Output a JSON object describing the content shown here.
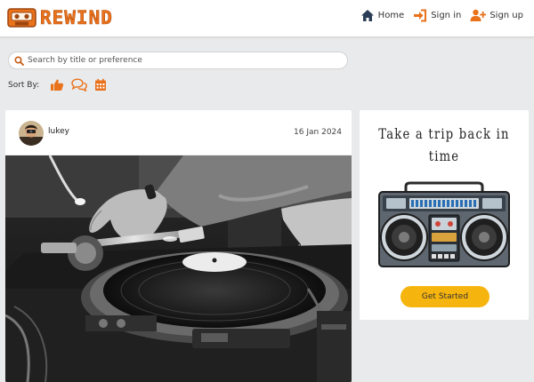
{
  "brand": {
    "name": "REWIND",
    "logo_icon": "cassette-tape-icon"
  },
  "nav": [
    {
      "label": "Home",
      "icon": "home-icon"
    },
    {
      "label": "Sign in",
      "icon": "sign-in-icon"
    },
    {
      "label": "Sign up",
      "icon": "user-plus-icon"
    }
  ],
  "search": {
    "placeholder": "Search by title or preference",
    "value": ""
  },
  "sort": {
    "label": "Sort By:",
    "options": [
      {
        "icon": "thumbs-up-icon"
      },
      {
        "icon": "comments-icon"
      },
      {
        "icon": "calendar-icon"
      }
    ]
  },
  "post": {
    "username": "lukey",
    "date": "16 Jan 2024",
    "image": "dj-turntable-photo"
  },
  "promo": {
    "title": "Take a trip back in time",
    "image": "boombox-illustration",
    "button": "Get Started"
  },
  "colors": {
    "accent": "#e9721b",
    "button": "#f6b40e",
    "background": "#e9eaeb",
    "nav_icon": "#2c3e57"
  }
}
